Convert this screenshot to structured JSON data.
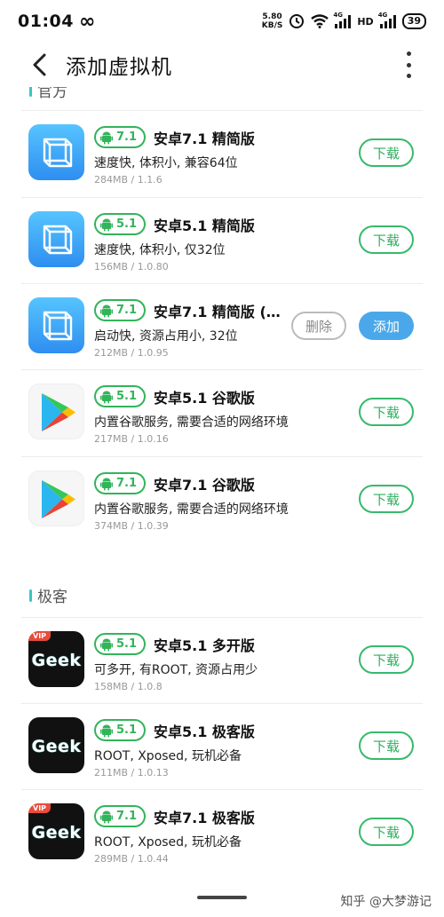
{
  "status": {
    "time": "01:04",
    "inf": "∞",
    "net_speed": "5.80",
    "net_unit": "KB/S",
    "sig_label": "4G",
    "hd": "HD",
    "battery": "39"
  },
  "header": {
    "title": "添加虚拟机"
  },
  "sections": [
    {
      "title": "官方"
    },
    {
      "title": "极客"
    }
  ],
  "apps": [
    {
      "version": "7.1",
      "name": "安卓7.1 精简版",
      "desc": "速度快, 体积小, 兼容64位",
      "meta": "284MB / 1.1.6",
      "icon": "vm-icon",
      "button": "下载"
    },
    {
      "version": "5.1",
      "name": "安卓5.1 精简版",
      "desc": "速度快, 体积小, 仅32位",
      "meta": "156MB / 1.0.80",
      "icon": "vm-icon",
      "button": "下载"
    },
    {
      "version": "7.1",
      "name": "安卓7.1 精简版 (…",
      "desc": "启动快, 资源占用小, 32位",
      "meta": "212MB / 1.0.95",
      "icon": "vm-icon",
      "delete_button": "删除",
      "button": "添加"
    },
    {
      "version": "5.1",
      "name": "安卓5.1 谷歌版",
      "desc": "内置谷歌服务, 需要合适的网络环境",
      "meta": "217MB / 1.0.16",
      "icon": "play-store-icon",
      "button": "下载"
    },
    {
      "version": "7.1",
      "name": "安卓7.1 谷歌版",
      "desc": "内置谷歌服务, 需要合适的网络环境",
      "meta": "374MB / 1.0.39",
      "icon": "play-store-icon",
      "button": "下载"
    },
    {
      "version": "5.1",
      "name": "安卓5.1 多开版",
      "desc": "可多开, 有ROOT, 资源占用少",
      "meta": "158MB / 1.0.8",
      "icon": "geek-vip-icon",
      "icon_text": "Geek",
      "vip": "VIP",
      "button": "下载"
    },
    {
      "version": "5.1",
      "name": "安卓5.1 极客版",
      "desc": "ROOT, Xposed, 玩机必备",
      "meta": "211MB / 1.0.13",
      "icon": "geek-icon",
      "icon_text": "Geek",
      "button": "下载"
    },
    {
      "version": "7.1",
      "name": "安卓7.1 极客版",
      "desc": "ROOT, Xposed, 玩机必备",
      "meta": "289MB / 1.0.44",
      "icon": "geek-vip-icon",
      "icon_text": "Geek",
      "vip": "VIP",
      "button": "下载"
    }
  ],
  "watermark": "知乎 @大梦游记",
  "colors": {
    "accent_green": "#32b45a",
    "add_blue": "#4aa8ea",
    "section_bar": "#3bc5c0"
  }
}
